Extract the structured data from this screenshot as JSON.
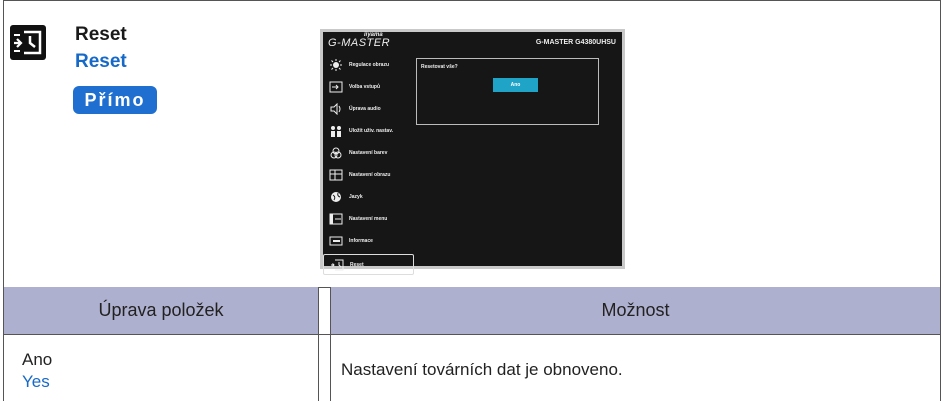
{
  "header": {
    "title_cz": "Reset",
    "title_en": "Reset",
    "badge": "Přímo"
  },
  "osd": {
    "logo_small": "iiyama",
    "logo": "G-MASTER",
    "model": "G-MASTER G4380UHSU",
    "menu": [
      {
        "label": "Regulace obrazu",
        "icon": "brightness-icon"
      },
      {
        "label": "Volba vstupů",
        "icon": "input-icon"
      },
      {
        "label": "Úprava audio",
        "icon": "speaker-icon"
      },
      {
        "label": "Uložit uživ. nastav.",
        "icon": "user-settings-icon"
      },
      {
        "label": "Nastavení barev",
        "icon": "color-icon"
      },
      {
        "label": "Nastavení obrazu",
        "icon": "picture-icon"
      },
      {
        "label": "Jazyk",
        "icon": "globe-icon"
      },
      {
        "label": "Nastavení menu",
        "icon": "menu-icon"
      },
      {
        "label": "Informace",
        "icon": "info-icon"
      },
      {
        "label": "Reset",
        "icon": "reset-icon",
        "active": true
      }
    ],
    "prompt": "Resetovat vše?",
    "yes_button": "Ano"
  },
  "table": {
    "col1_header": "Úprava položek",
    "col2_header": "Možnost",
    "rows": [
      {
        "item_cz": "Ano",
        "item_en": "Yes",
        "description": "Nastavení továrních dat je obnoveno."
      }
    ]
  },
  "colors": {
    "accent_blue": "#1f6fd0",
    "header_bg": "#aeb0cf",
    "osd_button": "#1fa3c7"
  }
}
